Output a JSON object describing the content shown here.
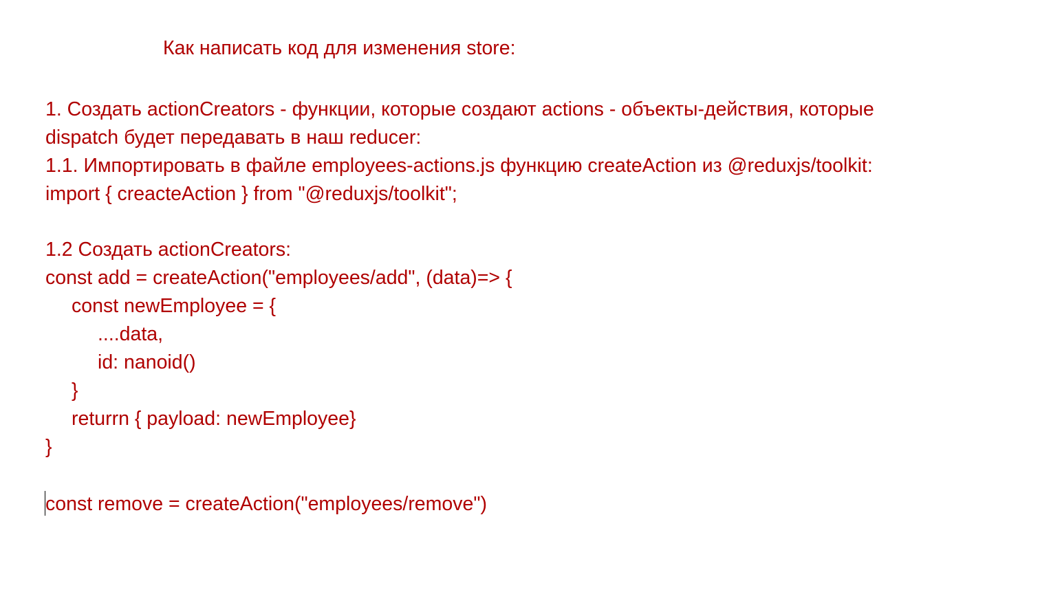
{
  "document": {
    "title": "Как написать код для изменения store:",
    "lines": [
      "1. Создать actionCreators - функции, которые создают actions - объекты-действия, которые",
      "dispatch будет передавать в наш reducer:",
      "1.1. Импортировать в файле employees-actions.js функцию createAction из @reduxjs/toolkit:",
      "import { creacteAction } from \"@reduxjs/toolkit\";",
      "1.2 Создать actionCreators:",
      "const add = createAction(\"employees/add\", (data)=> {",
      "const newEmployee = {",
      "....data,",
      "id: nanoid()",
      "}",
      "returrn { payload: newEmployee}",
      "}",
      "const remove = createAction(\"employees/remove\")"
    ]
  },
  "colors": {
    "text": "#b00000",
    "background": "#ffffff",
    "caret": "#000000"
  }
}
